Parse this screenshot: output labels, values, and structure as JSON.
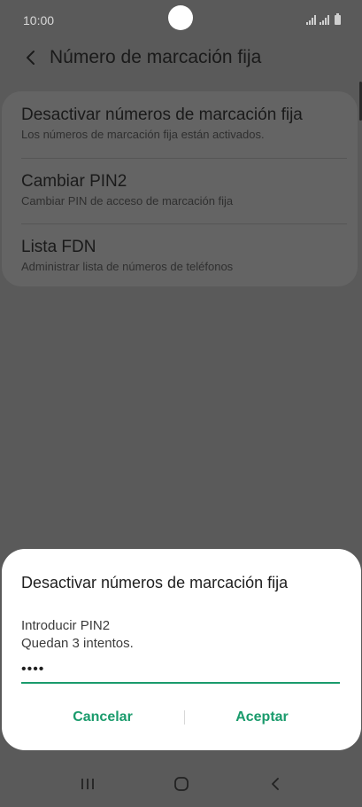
{
  "status_bar": {
    "time": "10:00",
    "icons": [
      "signal-icon",
      "signal-icon",
      "battery-icon"
    ]
  },
  "header": {
    "back_icon": "chevron-left-icon",
    "title": "Número de marcación fija"
  },
  "settings": {
    "items": [
      {
        "title": "Desactivar números de marcación fija",
        "subtitle": "Los números de marcación fija están activados."
      },
      {
        "title": "Cambiar PIN2",
        "subtitle": "Cambiar PIN de acceso de marcación fija"
      },
      {
        "title": "Lista FDN",
        "subtitle": "Administrar lista de números de teléfonos"
      }
    ]
  },
  "dialog": {
    "title": "Desactivar números de marcación fija",
    "prompt": "Introducir PIN2",
    "attempts": "Quedan 3 intentos.",
    "pin_value": "••••",
    "cancel_label": "Cancelar",
    "accept_label": "Aceptar"
  },
  "nav_bar": {
    "icons": [
      "recent-apps-icon",
      "home-icon",
      "back-icon"
    ]
  },
  "colors": {
    "accent": "#1a9b6c",
    "dim_background": "#5a5a5a",
    "dialog_background": "#ffffff"
  }
}
